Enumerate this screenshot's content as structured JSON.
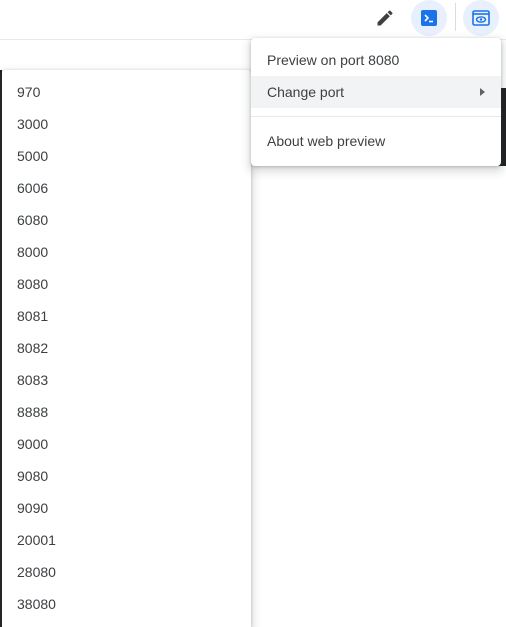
{
  "toolbar": {
    "edit_icon": "pencil-icon",
    "terminal_icon": "terminal-icon",
    "preview_icon": "web-preview-icon",
    "accent_color": "#1a73e8"
  },
  "preview_menu": {
    "items": [
      {
        "label": "Preview on port 8080"
      },
      {
        "label": "Change port",
        "has_submenu": true
      },
      {
        "label": "About web preview"
      }
    ]
  },
  "port_menu": {
    "ports": [
      "970",
      "3000",
      "5000",
      "6006",
      "6080",
      "8000",
      "8080",
      "8081",
      "8082",
      "8083",
      "8888",
      "9000",
      "9080",
      "9090",
      "20001",
      "28080",
      "38080"
    ]
  }
}
